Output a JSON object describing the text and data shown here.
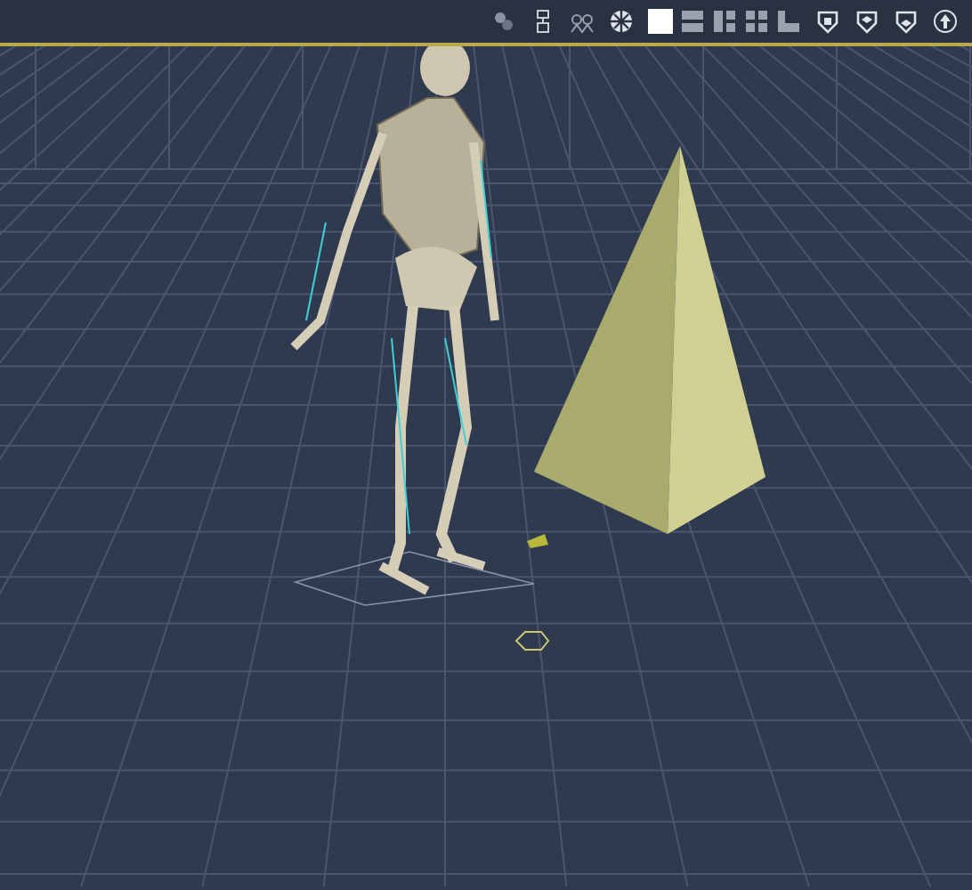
{
  "viewport": {
    "toolbar": {
      "layouts": [
        {
          "kind": "single",
          "selected": true
        },
        {
          "kind": "rows",
          "selected": false
        },
        {
          "kind": "split",
          "selected": false
        },
        {
          "kind": "quad",
          "selected": false
        },
        {
          "kind": "corner",
          "selected": false
        }
      ]
    }
  }
}
